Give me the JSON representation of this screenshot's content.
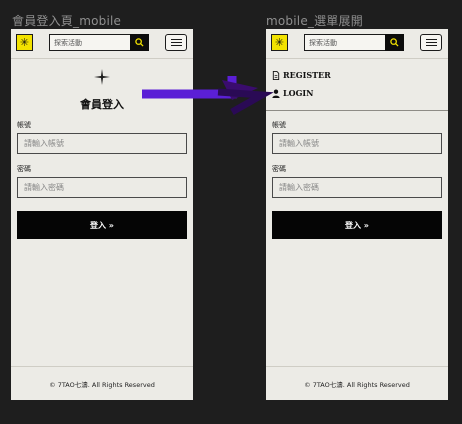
{
  "frames": {
    "left": {
      "title": "會員登入頁_mobile"
    },
    "right": {
      "title": "mobile_選單展開"
    }
  },
  "header": {
    "logo_symbol": "✳",
    "search_placeholder": "探索活動",
    "search_icon": "search-icon",
    "menu_icon": "hamburger-menu-icon"
  },
  "login": {
    "heading": "會員登入",
    "account_label": "帳號",
    "account_placeholder": "請輸入帳號",
    "password_label": "密碼",
    "password_placeholder": "請輸入密碼",
    "submit_label": "登入 »"
  },
  "menu": {
    "register": "REGISTER",
    "login": "LOGIN"
  },
  "footer": {
    "copyright": "© 7TAO七濤. All Rights Reserved"
  },
  "colors": {
    "page_bg": "#1e1e1e",
    "frame_bg": "#ecebe6",
    "logo_yellow": "#f2e200",
    "button_black": "#050505",
    "arrow_purple": "#5b1fd6"
  }
}
